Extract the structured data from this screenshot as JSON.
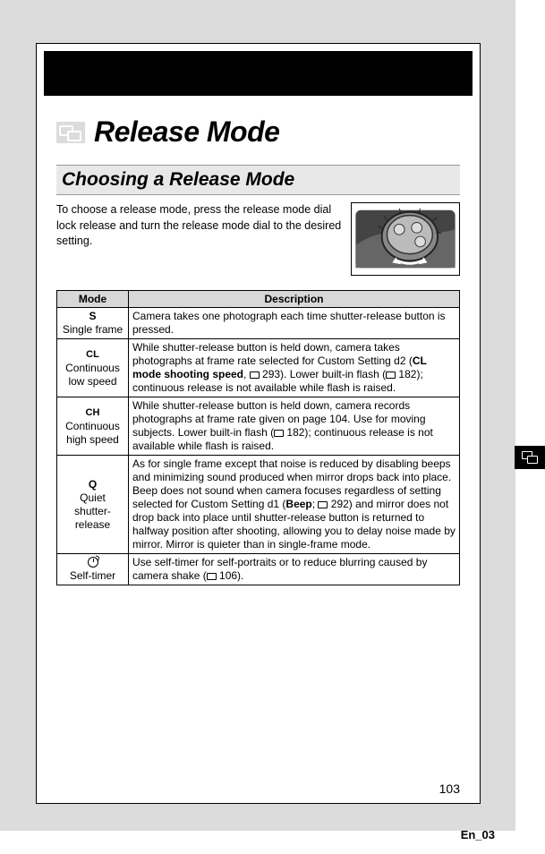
{
  "chapter_title": "Release Mode",
  "section_title": "Choosing a Release Mode",
  "intro": "To choose a release mode, press the release mode dial lock release and turn the release mode dial to the desired setting.",
  "table": {
    "headers": [
      "Mode",
      "Description"
    ],
    "rows": [
      {
        "symbol": "S",
        "label": "Single frame",
        "desc_pre": "Camera takes one photograph each time shutter-release button is pressed.",
        "desc_post": ""
      },
      {
        "symbol": "CL",
        "label": "Continuous low speed",
        "desc_pre": "While shutter-release button is held down, camera takes photographs at frame rate selected for Custom Setting d2 (",
        "bold1": "CL mode shooting speed",
        "ref1": " 293). Lower built-in flash (",
        "ref2": " 182); continuous release is not available while flash is raised.",
        "desc_post": ""
      },
      {
        "symbol": "CH",
        "label": "Continuous high speed",
        "desc_pre": "While shutter-release button is held down, camera records photographs at frame rate given on page 104. Use for moving subjects. Lower built-in flash (",
        "ref1": " 182); continuous release is not available while flash is raised.",
        "desc_post": ""
      },
      {
        "symbol": "Q",
        "label": "Quiet shutter-release",
        "desc_pre": "As for single frame except that noise is reduced by disabling beeps and minimizing sound produced when mirror drops back into place. Beep does not sound when camera focuses regardless of setting selected for Custom Setting d1 (",
        "bold1": "Beep",
        "ref1": " 292) and mirror does not drop back into place until shutter-release button is returned to halfway position after shooting, allowing you to delay noise made by mirror. Mirror is quieter than in single-frame mode.",
        "desc_post": ""
      },
      {
        "symbol": "timer",
        "label": "Self-timer",
        "desc_pre": "Use self-timer for self-portraits or to reduce blurring caused by camera shake (",
        "ref1": " 106).",
        "desc_post": ""
      }
    ]
  },
  "page_number": "103",
  "footer": "En_03"
}
